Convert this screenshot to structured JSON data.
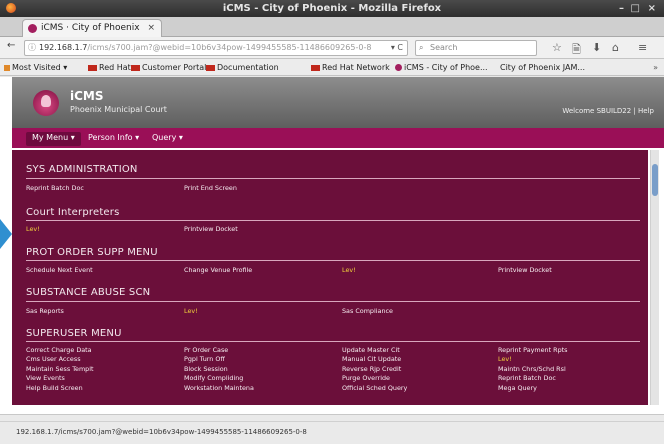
{
  "window": {
    "title": "iCMS - City of Phoenix - Mozilla Firefox",
    "controls": [
      "–",
      "□",
      "×"
    ]
  },
  "tabs": [
    {
      "label": "iCMS · City of Phoenix",
      "close": "×"
    }
  ],
  "new_tab": "+",
  "navbar": {
    "back": "←",
    "url_host": "192.168.1.7",
    "url_path": "/icms/s700.jam?@webid=10b6v34pow-1499455585-11486609265-0-8",
    "url_tail": "▾ C",
    "search_placeholder": "Search",
    "tool_icons": [
      "☆",
      "🗎",
      "⬇",
      "⌂",
      "≡"
    ]
  },
  "bookmarks": [
    {
      "label": "Most Visited ▾",
      "icon": "orange"
    },
    {
      "label": "Red Hat",
      "icon": "red"
    },
    {
      "label": "Customer Portal",
      "icon": "red"
    },
    {
      "label": "Documentation",
      "icon": "red"
    },
    {
      "label": "Red Hat Network",
      "icon": "red"
    },
    {
      "label": "iCMS - City of Phoe...",
      "icon": "icms"
    },
    {
      "label": "City of Phoenix JAM...",
      "icon": "page"
    }
  ],
  "bookmarks_more": "»",
  "app": {
    "name": "iCMS",
    "subtitle": "Phoenix Municipal Court",
    "welcome": "Welcome SBUILD22 | Help"
  },
  "menu": [
    {
      "label": "My Menu ▾",
      "active": true
    },
    {
      "label": "Person Info ▾",
      "active": false
    },
    {
      "label": "Query ▾",
      "active": false
    }
  ],
  "sections": [
    {
      "title": "SYS ADMINISTRATION",
      "links": [
        {
          "label": "Reprint Batch Doc",
          "col": 0,
          "row": 0,
          "highlight": false
        },
        {
          "label": "Print End Screen",
          "col": 1,
          "row": 0,
          "highlight": false
        }
      ]
    },
    {
      "title": "Court Interpreters",
      "links": [
        {
          "label": "Lev!",
          "col": 0,
          "row": 0,
          "highlight": true
        },
        {
          "label": "Printview Docket",
          "col": 1,
          "row": 0,
          "highlight": false
        }
      ]
    },
    {
      "title": "PROT ORDER SUPP MENU",
      "links": [
        {
          "label": "Schedule Next Event",
          "col": 0,
          "row": 0,
          "highlight": false
        },
        {
          "label": "Change Venue Profile",
          "col": 1,
          "row": 0,
          "highlight": false
        },
        {
          "label": "Lev!",
          "col": 2,
          "row": 0,
          "highlight": true
        },
        {
          "label": "Printview Docket",
          "col": 3,
          "row": 0,
          "highlight": false
        }
      ]
    },
    {
      "title": "SUBSTANCE ABUSE SCN",
      "links": [
        {
          "label": "Sas Reports",
          "col": 0,
          "row": 0,
          "highlight": false
        },
        {
          "label": "Lev!",
          "col": 1,
          "row": 0,
          "highlight": true
        },
        {
          "label": "Sas Compliance",
          "col": 2,
          "row": 0,
          "highlight": false
        }
      ]
    },
    {
      "title": "SUPERUSER MENU",
      "links": [
        {
          "label": "Correct Charge Data",
          "col": 0,
          "row": 0,
          "highlight": false
        },
        {
          "label": "Cms User Access",
          "col": 0,
          "row": 1,
          "highlight": false
        },
        {
          "label": "Maintain Sess Templt",
          "col": 0,
          "row": 2,
          "highlight": false
        },
        {
          "label": "View Events",
          "col": 0,
          "row": 3,
          "highlight": false
        },
        {
          "label": "Help Build Screen",
          "col": 0,
          "row": 4,
          "highlight": false
        },
        {
          "label": "Pr Order Case",
          "col": 1,
          "row": 0,
          "highlight": false
        },
        {
          "label": "Pgpl Turn Off",
          "col": 1,
          "row": 1,
          "highlight": false
        },
        {
          "label": "Block Session",
          "col": 1,
          "row": 2,
          "highlight": false
        },
        {
          "label": "Modify Compliding",
          "col": 1,
          "row": 3,
          "highlight": false
        },
        {
          "label": "Workstation Maintena",
          "col": 1,
          "row": 4,
          "highlight": false
        },
        {
          "label": "Update Master Cit",
          "col": 2,
          "row": 0,
          "highlight": false
        },
        {
          "label": "Manual Cit Update",
          "col": 2,
          "row": 1,
          "highlight": false
        },
        {
          "label": "Reverse Rjp Credit",
          "col": 2,
          "row": 2,
          "highlight": false
        },
        {
          "label": "Purge Override",
          "col": 2,
          "row": 3,
          "highlight": false
        },
        {
          "label": "Official Sched Query",
          "col": 2,
          "row": 4,
          "highlight": false
        },
        {
          "label": "Reprint Payment Rpts",
          "col": 3,
          "row": 0,
          "highlight": false
        },
        {
          "label": "Lev!",
          "col": 3,
          "row": 1,
          "highlight": true
        },
        {
          "label": "Maintn Chrs/Schd Rsl",
          "col": 3,
          "row": 2,
          "highlight": false
        },
        {
          "label": "Reprint Batch Doc",
          "col": 3,
          "row": 3,
          "highlight": false
        },
        {
          "label": "Mega Query",
          "col": 3,
          "row": 4,
          "highlight": false
        }
      ]
    }
  ],
  "status_url": "192.168.1.7/icms/s700.jam?@webid=10b6v34pow-1499455585-11486609265-0-8",
  "colors": {
    "brand": "#9a0f57",
    "panel": "#6b0f3a",
    "highlight_link": "#f2d23a"
  }
}
